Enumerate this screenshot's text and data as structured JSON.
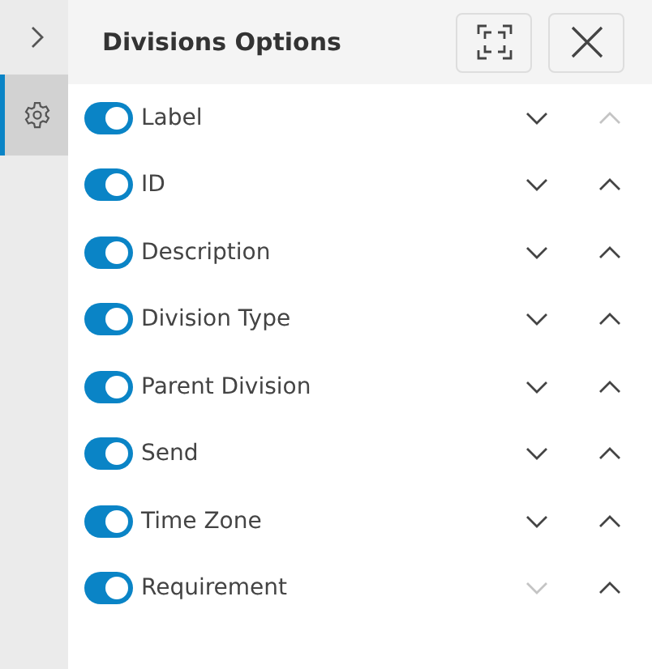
{
  "rail": {
    "items": [
      {
        "kind": "expand",
        "selected": false
      },
      {
        "kind": "settings",
        "selected": true
      }
    ]
  },
  "panel": {
    "title": "Divisions Options"
  },
  "fields": [
    {
      "label": "Label",
      "on": true,
      "down_disabled": false,
      "up_disabled": true
    },
    {
      "label": "ID",
      "on": true,
      "down_disabled": false,
      "up_disabled": false
    },
    {
      "label": "Description",
      "on": true,
      "down_disabled": false,
      "up_disabled": false
    },
    {
      "label": "Division Type",
      "on": true,
      "down_disabled": false,
      "up_disabled": false
    },
    {
      "label": "Parent Division",
      "on": true,
      "down_disabled": false,
      "up_disabled": false
    },
    {
      "label": "Send",
      "on": true,
      "down_disabled": false,
      "up_disabled": false
    },
    {
      "label": "Time Zone",
      "on": true,
      "down_disabled": false,
      "up_disabled": false
    },
    {
      "label": "Requirement",
      "on": true,
      "down_disabled": true,
      "up_disabled": false
    }
  ]
}
